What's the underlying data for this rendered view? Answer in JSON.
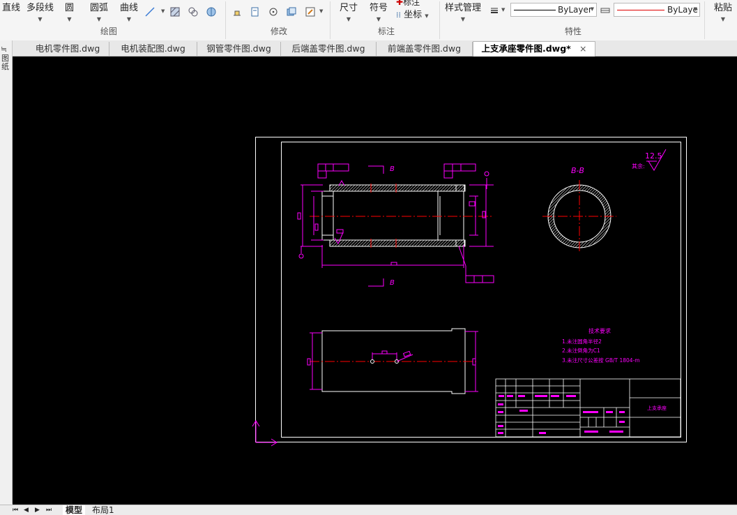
{
  "ribbon": {
    "draw_tools": {
      "line": "直线",
      "polyline": "多段线",
      "circle": "圆",
      "arc": "圆弧",
      "curve": "曲线"
    },
    "groups": {
      "draw": "绘图",
      "modify": "修改",
      "annotate": "标注",
      "properties": "特性"
    },
    "annotate_tools": {
      "dimension": "尺寸",
      "symbol": "符号",
      "label_cut": "标注",
      "coordinate": "坐标"
    },
    "style_manager": "样式管理",
    "linetype": {
      "value": "ByLayer"
    },
    "color": {
      "value": "ByLaye"
    },
    "paste": "粘贴"
  },
  "colors": {
    "magenta": "#ff00ff",
    "red": "#ff0000",
    "white": "#ffffff",
    "background": "#000000"
  },
  "tabs": [
    {
      "label": "电机零件图.dwg"
    },
    {
      "label": "电机装配图.dwg"
    },
    {
      "label": "钢管零件图.dwg"
    },
    {
      "label": "后端盖零件图.dwg"
    },
    {
      "label": "前端盖零件图.dwg"
    },
    {
      "label": "上支承座零件图.dwg*",
      "active": true,
      "close": "×"
    }
  ],
  "left_panel": {
    "chars": [
      "图",
      "纸"
    ]
  },
  "drawing": {
    "section_label": "B",
    "section_view_title": "B-B",
    "roughness_value": "12.5",
    "roughness_prefix": "其余:",
    "tech_req_title": "技术要求",
    "tech_reqs": [
      "1.未注圆角半径2",
      "2.未注倒角为C1",
      "3.未注尺寸公差按 GB/T 1804-m"
    ],
    "title_block_part_name": "上支承座"
  },
  "bottom_tabs": {
    "model": "模型",
    "layout1": "布局1",
    "nav": [
      "⏮",
      "◀",
      "▶",
      "⏭"
    ]
  }
}
